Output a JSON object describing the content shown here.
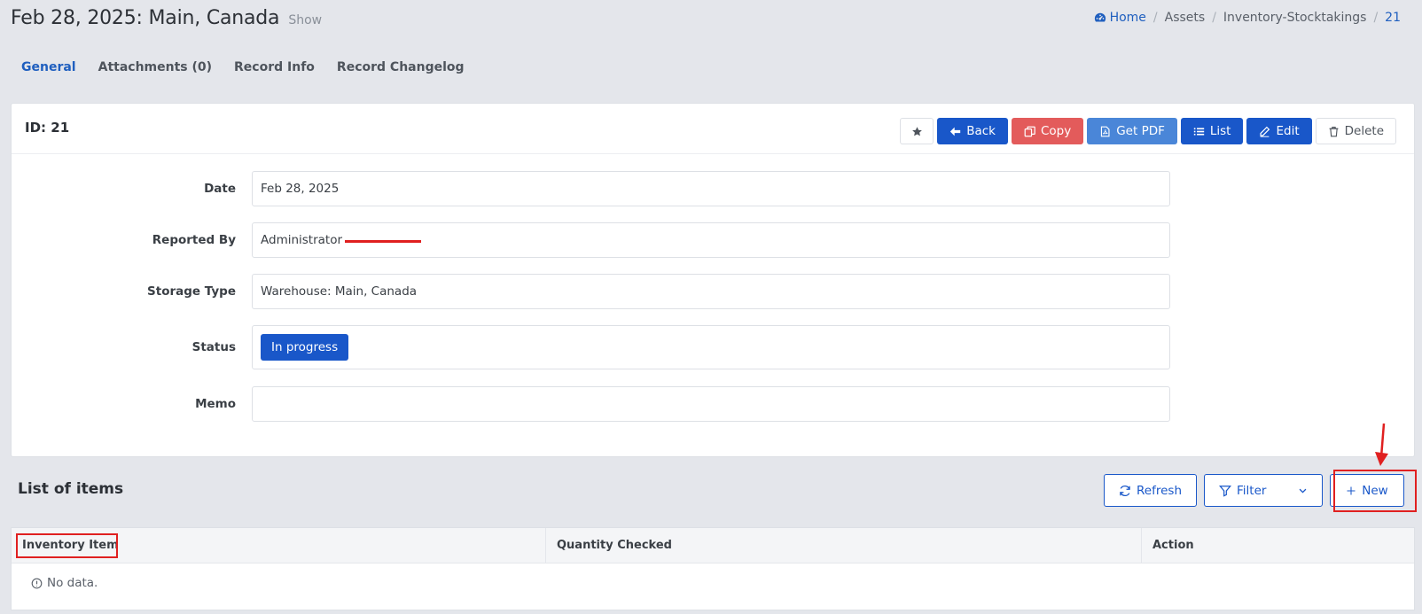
{
  "header": {
    "title": "Feb 28, 2025: Main, Canada",
    "subtitle": "Show"
  },
  "breadcrumb": {
    "items": [
      "Home",
      "Assets",
      "Inventory-Stocktakings",
      "21"
    ]
  },
  "tabs": [
    {
      "label": "General",
      "active": true
    },
    {
      "label": "Attachments (0)",
      "active": false
    },
    {
      "label": "Record Info",
      "active": false
    },
    {
      "label": "Record Changelog",
      "active": false
    }
  ],
  "card": {
    "id_label": "ID: 21",
    "toolbar": {
      "back": "Back",
      "copy": "Copy",
      "pdf": "Get PDF",
      "list": "List",
      "edit": "Edit",
      "delete": "Delete"
    }
  },
  "form": {
    "date_label": "Date",
    "date_value": "Feb 28, 2025",
    "reported_label": "Reported By",
    "reported_value": "Administrator",
    "storage_label": "Storage Type",
    "storage_value": "Warehouse: Main, Canada",
    "status_label": "Status",
    "status_value": "In progress",
    "memo_label": "Memo",
    "memo_value": ""
  },
  "items_list": {
    "title": "List of items",
    "refresh": "Refresh",
    "filter": "Filter",
    "new": "New",
    "columns": [
      "Inventory Item",
      "Quantity Checked",
      "Action"
    ],
    "empty_text": "No data."
  },
  "colors": {
    "primary": "#1957c9",
    "danger": "#e35b5b",
    "annotation": "#e02020"
  }
}
